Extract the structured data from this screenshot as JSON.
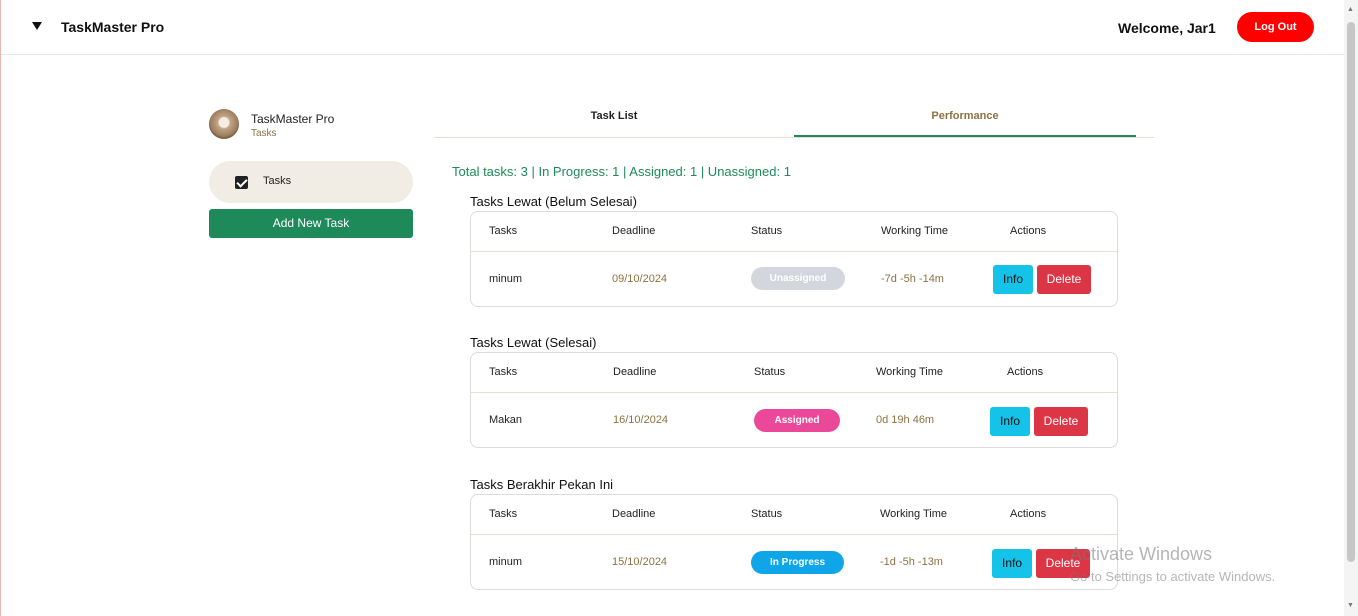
{
  "header": {
    "app_title": "TaskMaster Pro",
    "welcome": "Welcome, Jar1",
    "logout_label": "Log Out"
  },
  "sidebar": {
    "title": "TaskMaster Pro",
    "subtitle": "Tasks",
    "items": [
      {
        "label": "Tasks",
        "icon": "checkbox-icon"
      }
    ],
    "add_task_label": "Add New Task"
  },
  "tabs": [
    {
      "label": "Task List",
      "active": false
    },
    {
      "label": "Performance",
      "active": true
    }
  ],
  "summary": "Total tasks: 3 | In Progress: 1 | Assigned: 1 | Unassigned: 1",
  "columns": [
    "Tasks",
    "Deadline",
    "Status",
    "Working Time",
    "Actions"
  ],
  "sections": [
    {
      "title": "Tasks Lewat (Belum Selesai)",
      "rows": [
        {
          "task": "minum",
          "deadline": "09/10/2024",
          "status": "Unassigned",
          "status_color": "#d3d6dc",
          "working_time": "-7d -5h -14m",
          "info": "Info",
          "delete": "Delete"
        }
      ]
    },
    {
      "title": "Tasks Lewat (Selesai)",
      "rows": [
        {
          "task": "Makan",
          "deadline": "16/10/2024",
          "status": "Assigned",
          "status_color": "#ec4899",
          "working_time": "0d 19h 46m",
          "info": "Info",
          "delete": "Delete"
        }
      ]
    },
    {
      "title": "Tasks Berakhir Pekan Ini",
      "rows": [
        {
          "task": "minum",
          "deadline": "15/10/2024",
          "status": "In Progress",
          "status_color": "#0ea5e9",
          "working_time": "-1d -5h -13m",
          "info": "Info",
          "delete": "Delete"
        }
      ]
    }
  ],
  "watermark": {
    "title": "Activate Windows",
    "subtitle": "Go to Settings to activate Windows."
  },
  "colors": {
    "primary_green": "#1e8a5a",
    "logout_red": "#ff0000",
    "info_cyan": "#15c2e8",
    "delete_red": "#dc3545",
    "muted_brown": "#8b7343"
  }
}
